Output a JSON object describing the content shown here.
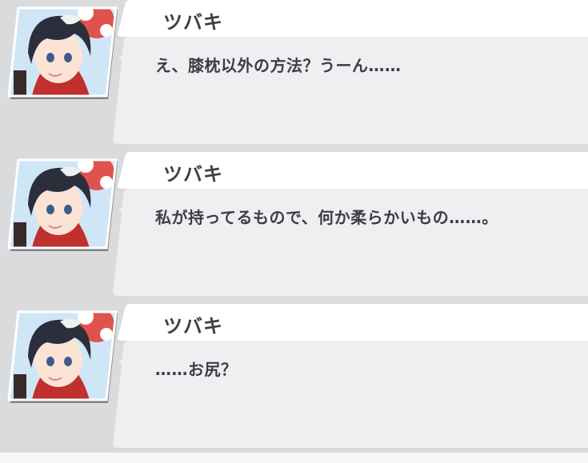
{
  "chat": {
    "messages": [
      {
        "sender": "ツバキ",
        "text": "え、膝枕以外の方法？うーん……"
      },
      {
        "sender": "ツバキ",
        "text": "私が持ってるもので、何か柔らかいもの……。"
      },
      {
        "sender": "ツバキ",
        "text": "……お尻？"
      }
    ]
  },
  "colors": {
    "background": "#dadbdd",
    "name_tab": "#ffffff",
    "bubble": "#efeff1",
    "text": "#3b3d46"
  },
  "icons": {
    "avatar": "character-avatar-icon"
  }
}
